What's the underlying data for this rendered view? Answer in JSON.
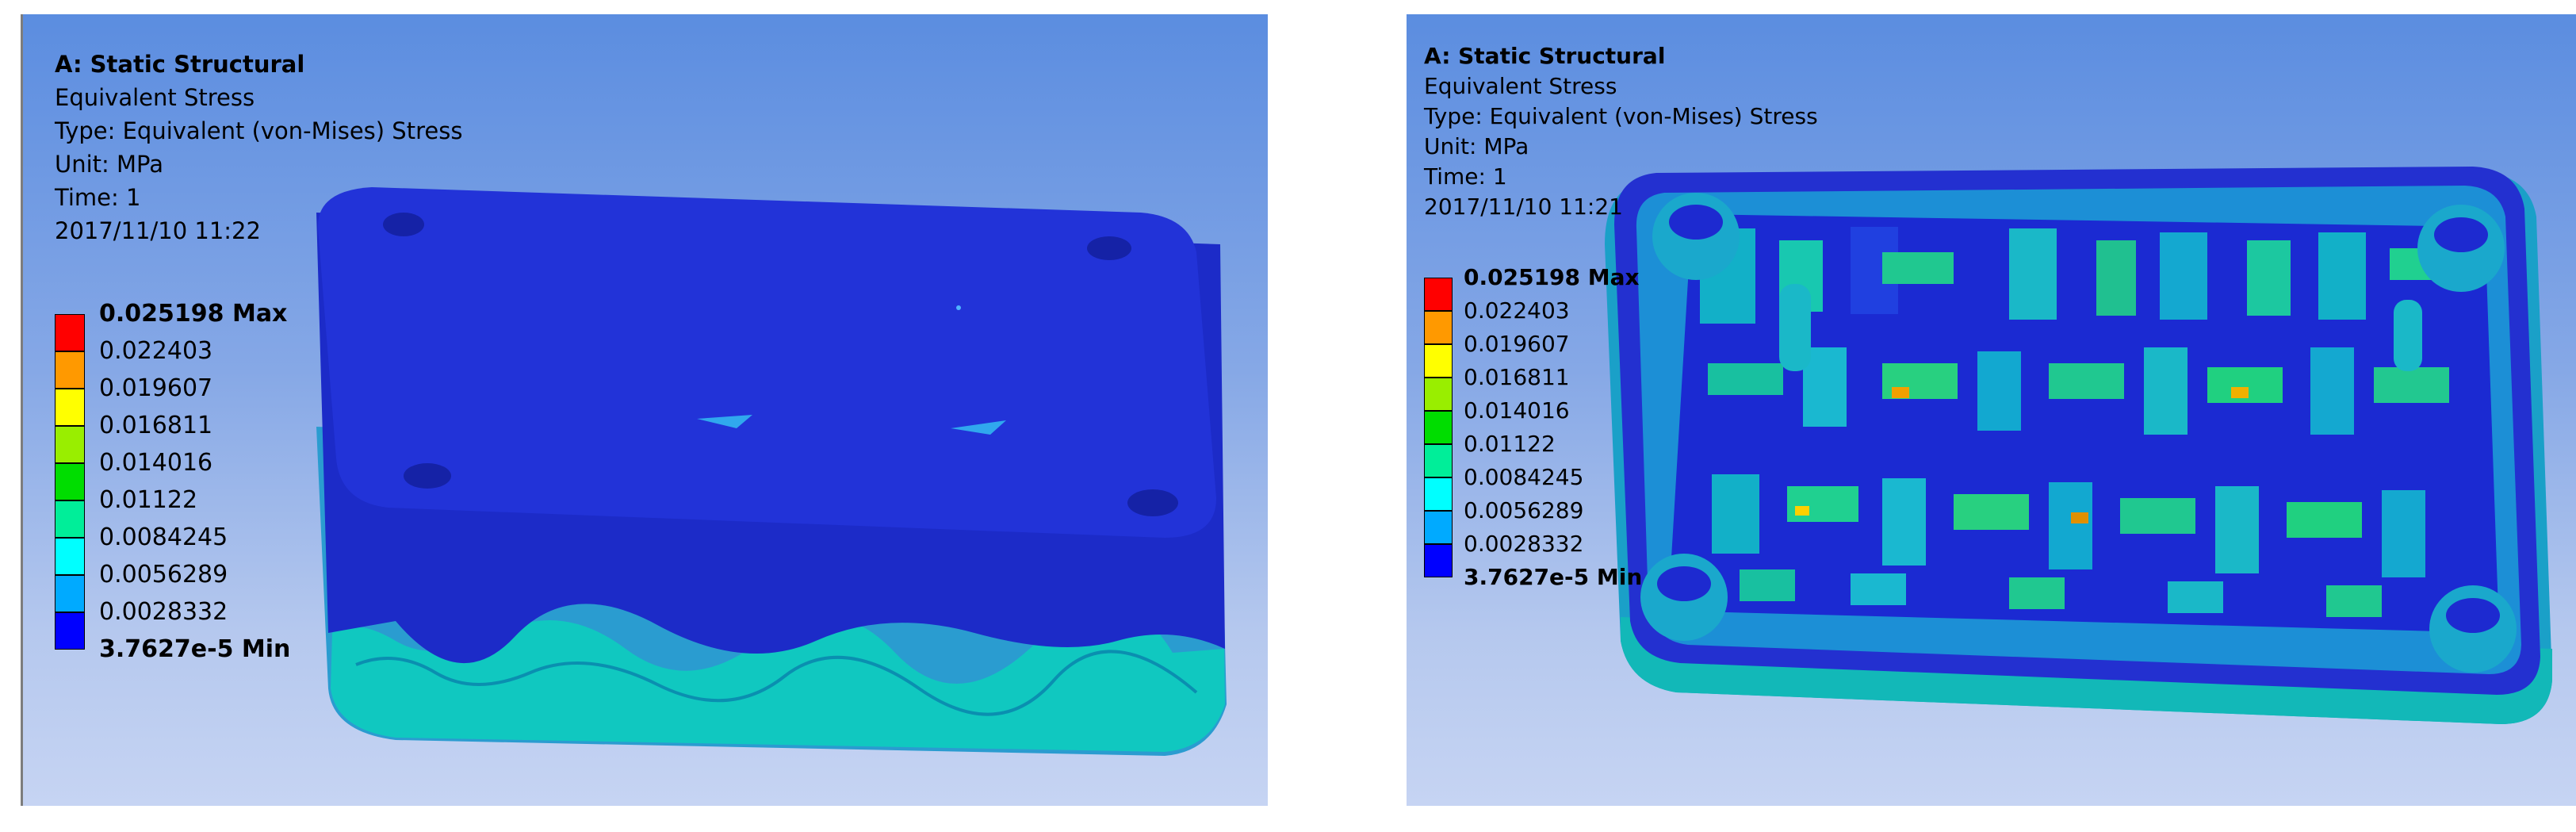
{
  "viewports": [
    {
      "title": "A: Static Structural",
      "result": "Equivalent Stress",
      "type": "Type: Equivalent (von-Mises) Stress",
      "unit": "Unit: MPa",
      "time": "Time: 1",
      "timestamp": "2017/11/10 11:22"
    },
    {
      "title": "A: Static Structural",
      "result": "Equivalent Stress",
      "type": "Type: Equivalent (von-Mises) Stress",
      "unit": "Unit: MPa",
      "time": "Time: 1",
      "timestamp": "2017/11/10 11:21"
    }
  ],
  "legend": {
    "labels": [
      "0.025198 Max",
      "0.022403",
      "0.019607",
      "0.016811",
      "0.014016",
      "0.01122",
      "0.0084245",
      "0.0056289",
      "0.0028332",
      "3.7627e-5 Min"
    ],
    "colors": [
      "#ff0000",
      "#ff9900",
      "#ffff00",
      "#99ee00",
      "#00dd00",
      "#00ee99",
      "#00ffff",
      "#00aaff",
      "#0000ff"
    ]
  },
  "colors": {
    "bg_top": "#5b8de0",
    "bg_bottom": "#c6d4f3",
    "part_blue": "#1d33d8",
    "part_cyan": "#10b8c8"
  }
}
